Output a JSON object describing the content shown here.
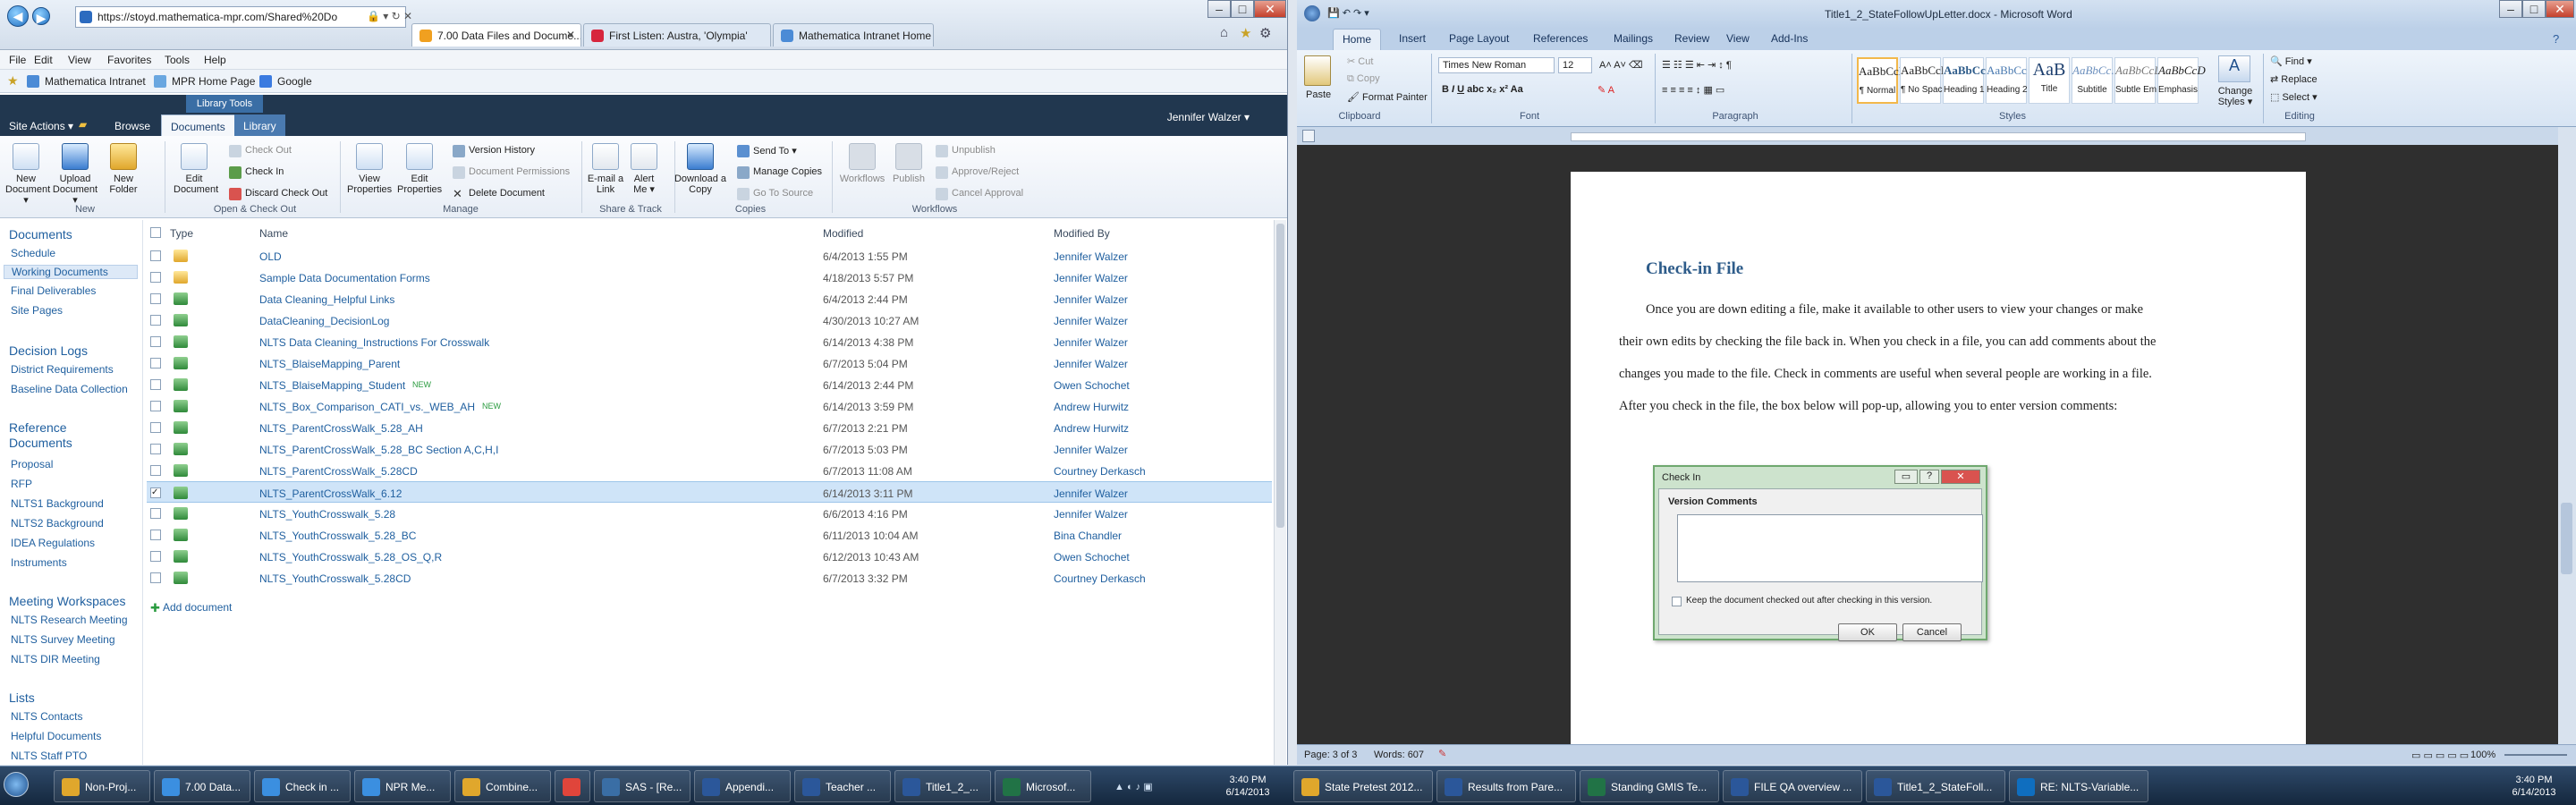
{
  "ie": {
    "address": "https://stoyd.mathematica-mpr.com/Shared%20Do",
    "tabs": [
      {
        "label": "7.00 Data Files and Docume...",
        "active": true
      },
      {
        "label": "First Listen: Austra, 'Olympia'",
        "active": false
      },
      {
        "label": "Mathematica Intranet Home",
        "active": false
      }
    ],
    "menu": [
      "File",
      "Edit",
      "View",
      "Favorites",
      "Tools",
      "Help"
    ],
    "favorites": [
      "Mathematica Intranet",
      "MPR Home Page",
      "Google"
    ],
    "window_controls": [
      "–",
      "□",
      "✕"
    ]
  },
  "sp": {
    "library_tools": "Library Tools",
    "top_tabs": [
      "Site Actions ▾",
      "Browse",
      "Documents",
      "Library"
    ],
    "user": "Jennifer Walzer ▾",
    "ribbon": {
      "new_document": "New Document ▾",
      "upload_document": "Upload Document ▾",
      "new_folder": "New Folder",
      "edit_document": "Edit Document",
      "check_out": "Check Out",
      "check_in": "Check In",
      "discard_check_out": "Discard Check Out",
      "view_properties": "View Properties",
      "edit_properties": "Edit Properties",
      "version_history": "Version History",
      "document_permissions": "Document Permissions",
      "delete_document": "Delete Document",
      "email_link": "E-mail a Link",
      "alert_me": "Alert Me ▾",
      "download_copy": "Download a Copy",
      "send_to": "Send To ▾",
      "manage_copies": "Manage Copies",
      "go_to_source": "Go To Source",
      "workflows": "Workflows",
      "publish": "Publish",
      "unpublish": "Unpublish",
      "approve_reject": "Approve/Reject",
      "cancel_approval": "Cancel Approval",
      "groups": {
        "new": "New",
        "open_checkout": "Open & Check Out",
        "manage": "Manage",
        "share_track": "Share & Track",
        "copies": "Copies",
        "workflows": "Workflows"
      }
    },
    "quicklaunch": {
      "documents": "Documents",
      "documents_items": [
        "Schedule",
        "Working Documents",
        "Final Deliverables",
        "Site Pages"
      ],
      "decision_logs": "Decision Logs",
      "decision_items": [
        "District Requirements",
        "Baseline Data Collection"
      ],
      "reference": "Reference Documents",
      "reference_items": [
        "Proposal",
        "RFP",
        "NLTS1 Background",
        "NLTS2 Background",
        "IDEA Regulations",
        "Instruments"
      ],
      "meeting": "Meeting Workspaces",
      "meeting_items": [
        "NLTS Research Meeting",
        "NLTS Survey Meeting",
        "NLTS DIR Meeting"
      ],
      "lists": "Lists",
      "lists_items": [
        "NLTS Contacts",
        "Helpful Documents",
        "NLTS Staff PTO"
      ]
    },
    "columns": [
      "Type",
      "Name",
      "Modified",
      "Modified By"
    ],
    "rows": [
      {
        "name": "OLD",
        "modified": "6/4/2013 1:55 PM",
        "by": "Jennifer Walzer",
        "type": "folder",
        "new": ""
      },
      {
        "name": "Sample Data Documentation Forms",
        "modified": "4/18/2013 5:57 PM",
        "by": "Jennifer Walzer",
        "type": "folder",
        "new": ""
      },
      {
        "name": "Data Cleaning_Helpful Links",
        "modified": "6/4/2013 2:44 PM",
        "by": "Jennifer Walzer",
        "type": "excel",
        "new": ""
      },
      {
        "name": "DataCleaning_DecisionLog",
        "modified": "4/30/2013 10:27 AM",
        "by": "Jennifer Walzer",
        "type": "excel",
        "new": ""
      },
      {
        "name": "NLTS Data Cleaning_Instructions For Crosswalk",
        "modified": "6/14/2013 4:38 PM",
        "by": "Jennifer Walzer",
        "type": "excel",
        "new": ""
      },
      {
        "name": "NLTS_BlaiseMapping_Parent",
        "modified": "6/7/2013 5:04 PM",
        "by": "Jennifer Walzer",
        "type": "excel",
        "new": ""
      },
      {
        "name": "NLTS_BlaiseMapping_Student",
        "modified": "6/14/2013 2:44 PM",
        "by": "Owen Schochet",
        "type": "excel",
        "new": "NEW"
      },
      {
        "name": "NLTS_Box_Comparison_CATI_vs._WEB_AH",
        "modified": "6/14/2013 3:59 PM",
        "by": "Andrew Hurwitz",
        "type": "excel",
        "new": "NEW"
      },
      {
        "name": "NLTS_ParentCrossWalk_5.28_AH",
        "modified": "6/7/2013 2:21 PM",
        "by": "Andrew Hurwitz",
        "type": "excel",
        "new": ""
      },
      {
        "name": "NLTS_ParentCrossWalk_5.28_BC Section A,C,H,I",
        "modified": "6/7/2013 5:03 PM",
        "by": "Jennifer Walzer",
        "type": "excel",
        "new": ""
      },
      {
        "name": "NLTS_ParentCrossWalk_5.28CD",
        "modified": "6/7/2013 11:08 AM",
        "by": "Courtney Derkasch",
        "type": "excel",
        "new": ""
      },
      {
        "name": "NLTS_ParentCrossWalk_6.12",
        "modified": "6/14/2013 3:11 PM",
        "by": "Jennifer Walzer",
        "type": "excel",
        "new": "",
        "selected": true
      },
      {
        "name": "NLTS_YouthCrosswalk_5.28",
        "modified": "6/6/2013 4:16 PM",
        "by": "Jennifer Walzer",
        "type": "excel",
        "new": ""
      },
      {
        "name": "NLTS_YouthCrosswalk_5.28_BC",
        "modified": "6/11/2013 10:04 AM",
        "by": "Bina Chandler",
        "type": "excel",
        "new": ""
      },
      {
        "name": "NLTS_YouthCrosswalk_5.28_OS_Q,R",
        "modified": "6/12/2013 10:43 AM",
        "by": "Owen Schochet",
        "type": "excel",
        "new": ""
      },
      {
        "name": "NLTS_YouthCrosswalk_5.28CD",
        "modified": "6/7/2013 3:32 PM",
        "by": "Courtney Derkasch",
        "type": "excel",
        "new": ""
      }
    ],
    "add_document": "Add document"
  },
  "word": {
    "title": "Title1_2_StateFollowUpLetter.docx - Microsoft Word",
    "tabs": [
      "Home",
      "Insert",
      "Page Layout",
      "References",
      "Mailings",
      "Review",
      "View",
      "Add-Ins"
    ],
    "clipboard": {
      "paste": "Paste",
      "cut": "Cut",
      "copy": "Copy",
      "format_painter": "Format Painter",
      "label": "Clipboard"
    },
    "font": {
      "name": "Times New Roman",
      "size": "12",
      "label": "Font"
    },
    "paragraph_label": "Paragraph",
    "styles": [
      {
        "sample": "AaBbCcI",
        "name": "¶ Normal"
      },
      {
        "sample": "AaBbCcI",
        "name": "¶ No Spaci..."
      },
      {
        "sample": "AaBbCc",
        "name": "Heading 1"
      },
      {
        "sample": "AaBbCc",
        "name": "Heading 2"
      },
      {
        "sample": "AaB",
        "name": "Title"
      },
      {
        "sample": "AaBbCc.",
        "name": "Subtitle"
      },
      {
        "sample": "AaBbCcD",
        "name": "Subtle Em..."
      },
      {
        "sample": "AaBbCcD",
        "name": "Emphasis"
      }
    ],
    "styles_label": "Styles",
    "change_styles": "Change Styles ▾",
    "editing": {
      "find": "Find ▾",
      "replace": "Replace",
      "select": "Select ▾",
      "label": "Editing"
    },
    "heading": "Check-in File",
    "paragraph_lines": [
      "Once you are down editing a file, make it available to other users to view your changes or make",
      "their own edits by checking the file back in. When you check in a file, you can add comments about the",
      "changes you made to the file. Check in comments are useful when several people are working in a file.",
      "After you check in the file, the box below will pop-up, allowing you to enter version comments:"
    ],
    "dialog": {
      "title": "Check In",
      "version_comments": "Version Comments",
      "keep_checked_out": "Keep the document checked out after checking in this version.",
      "ok": "OK",
      "cancel": "Cancel"
    },
    "status": {
      "page": "Page: 3 of 3",
      "words": "Words: 607",
      "zoom": "100%"
    }
  },
  "taskbar_left": [
    {
      "label": "Non-Proj...",
      "icon": "folder-icon"
    },
    {
      "label": "7.00 Data...",
      "icon": "ie-icon"
    },
    {
      "label": "Check in ...",
      "icon": "ie-icon"
    },
    {
      "label": "NPR Me...",
      "icon": "ie-icon"
    },
    {
      "label": "Combine...",
      "icon": "folder-icon"
    },
    {
      "label": "",
      "icon": "chrome-icon"
    },
    {
      "label": "SAS - [Re...",
      "icon": "sas-icon"
    },
    {
      "label": "Appendi...",
      "icon": "word-icon"
    },
    {
      "label": "Teacher ...",
      "icon": "word-icon"
    },
    {
      "label": "Title1_2_...",
      "icon": "word-icon"
    },
    {
      "label": "Microsof...",
      "icon": "excel-icon"
    }
  ],
  "taskbar_right": [
    {
      "label": "State Pretest 2012...",
      "icon": "folder-icon"
    },
    {
      "label": "Results from Pare...",
      "icon": "word-icon"
    },
    {
      "label": "Standing GMIS Te...",
      "icon": "excel-icon"
    },
    {
      "label": "FILE QA overview ...",
      "icon": "word-icon"
    },
    {
      "label": "Title1_2_StateFoll...",
      "icon": "word-icon"
    },
    {
      "label": "RE: NLTS-Variable...",
      "icon": "outlook-icon"
    }
  ],
  "clock": {
    "time": "3:40 PM",
    "date": "6/14/2013"
  }
}
